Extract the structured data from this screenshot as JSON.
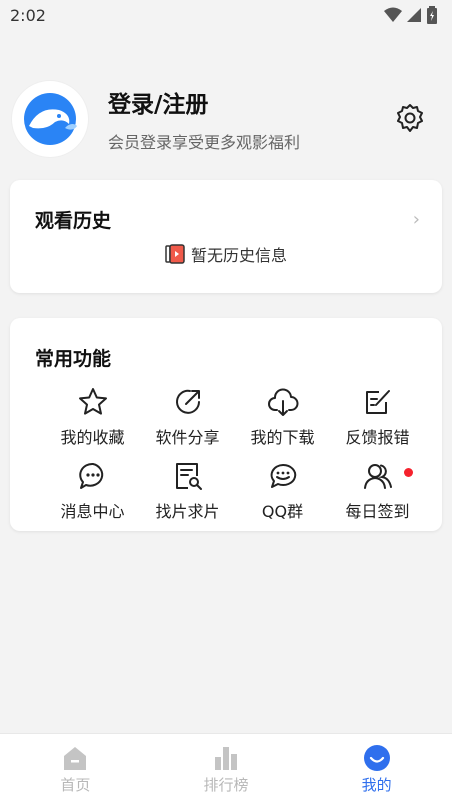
{
  "status_bar": {
    "time": "2:02"
  },
  "profile": {
    "title": "登录/注册",
    "subtitle": "会员登录享受更多观影福利"
  },
  "history": {
    "title": "观看历史",
    "empty_text": "暂无历史信息"
  },
  "functions": {
    "title": "常用功能",
    "items": [
      {
        "label": "我的收藏",
        "icon": "star-icon"
      },
      {
        "label": "软件分享",
        "icon": "share-icon"
      },
      {
        "label": "我的下载",
        "icon": "cloud-download-icon"
      },
      {
        "label": "反馈报错",
        "icon": "edit-note-icon"
      },
      {
        "label": "消息中心",
        "icon": "chat-bubble-icon"
      },
      {
        "label": "找片求片",
        "icon": "search-document-icon"
      },
      {
        "label": "QQ群",
        "icon": "chat-group-icon"
      },
      {
        "label": "每日签到",
        "icon": "users-icon"
      }
    ]
  },
  "bottom_nav": {
    "items": [
      {
        "label": "首页",
        "icon": "home-icon",
        "active": false
      },
      {
        "label": "排行榜",
        "icon": "bar-chart-icon",
        "active": false
      },
      {
        "label": "我的",
        "icon": "smile-icon",
        "active": true
      }
    ]
  },
  "colors": {
    "accent": "#2f6fed",
    "badge": "#f5222d",
    "inactive": "#b8b8b8",
    "background": "#f3f3f3"
  }
}
